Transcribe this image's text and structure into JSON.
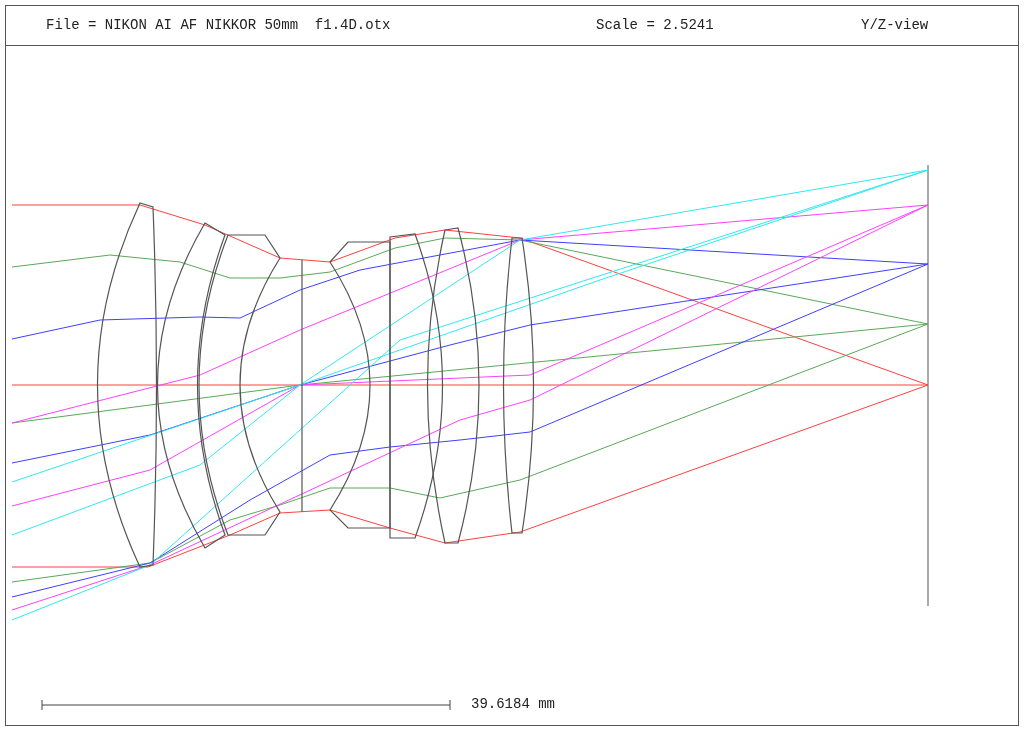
{
  "header": {
    "file": "File = NIKON AI AF NIKKOR 50mm  f1.4D.otx",
    "scale": "Scale = 2.5241",
    "view": "Y/Z-view"
  },
  "scale_bar": {
    "label": "39.6184 mm"
  }
}
